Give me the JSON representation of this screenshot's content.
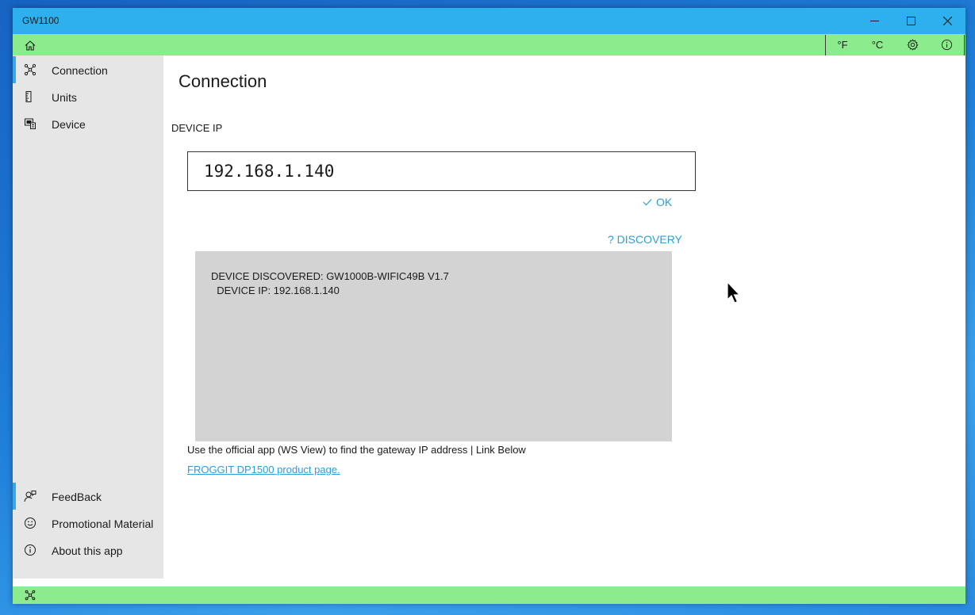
{
  "window": {
    "title": "GW1100"
  },
  "toolbar": {
    "fahrenheit": "°F",
    "celsius": "°C",
    "home_icon": "home-icon",
    "settings_icon": "gear-icon",
    "info_icon": "info-icon"
  },
  "sidebar": {
    "items": [
      {
        "label": "Connection",
        "icon": "network-icon",
        "selected": true
      },
      {
        "label": "Units",
        "icon": "ruler-icon",
        "selected": false
      },
      {
        "label": "Device",
        "icon": "device-icon",
        "selected": false
      }
    ],
    "footer_items": [
      {
        "label": "FeedBack",
        "icon": "feedback-icon",
        "selected": true
      },
      {
        "label": "Promotional Material",
        "icon": "smiley-icon",
        "selected": false
      },
      {
        "label": "About this app",
        "icon": "info-icon",
        "selected": false
      }
    ]
  },
  "main": {
    "title": "Connection",
    "ip_label": "DEVICE IP",
    "ip_value": "192.168.1.140",
    "ok_label": "OK",
    "discovery_label": "? DISCOVERY",
    "discovery_line1": "DEVICE DISCOVERED: GW1000B-WIFIC49B V1.7",
    "discovery_line2": "  DEVICE IP: 192.168.1.140",
    "hint": "Use the official app (WS View) to find the gateway IP address | Link Below",
    "link": "FROGGIT DP1500 product page."
  },
  "colors": {
    "titlebar": "#2fb0ee",
    "accent_green": "#8ceb8c",
    "sidebar": "#e6e6e6",
    "selection": "#3aa8e8",
    "link": "#2a9fd8",
    "discovery_box": "#d3d3d3"
  }
}
